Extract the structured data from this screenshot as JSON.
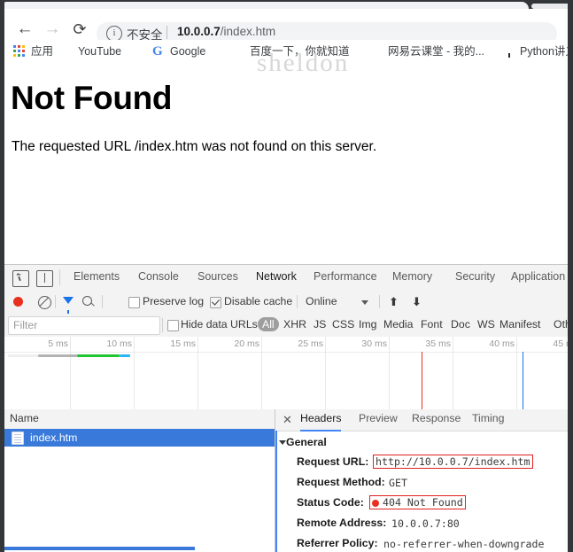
{
  "browser": {
    "nav": {
      "back": "←",
      "forward": "→",
      "reload": "⟳"
    },
    "omnibox": {
      "info_icon": "i",
      "security_label": "不安全",
      "separator": "|",
      "host": "10.0.0.7",
      "path": "/index.htm"
    },
    "bookmarks": [
      {
        "label": "应用",
        "icon": "apps-grid-icon"
      },
      {
        "label": "YouTube",
        "icon": "youtube-icon"
      },
      {
        "label": "Google",
        "icon": "google-icon",
        "glyph": "G"
      },
      {
        "label": "百度一下，你就知道",
        "icon": "baidu-icon"
      },
      {
        "label": "网易云课堂 - 我的...",
        "icon": "netease-icon"
      },
      {
        "label": "Python讲义",
        "icon": "github-icon"
      }
    ]
  },
  "page": {
    "heading": "Not Found",
    "body": "The requested URL /index.htm was not found on this server.",
    "watermark": "sheldon"
  },
  "devtools": {
    "tabs": [
      {
        "label": "Elements",
        "active": false
      },
      {
        "label": "Console",
        "active": false
      },
      {
        "label": "Sources",
        "active": false
      },
      {
        "label": "Network",
        "active": true
      },
      {
        "label": "Performance",
        "active": false
      },
      {
        "label": "Memory",
        "active": false
      },
      {
        "label": "Security",
        "active": false
      },
      {
        "label": "Application",
        "active": false
      }
    ],
    "toolbar": {
      "record_title": "record",
      "clear_title": "clear",
      "preserve_log": {
        "label": "Preserve log",
        "checked": false
      },
      "disable_cache": {
        "label": "Disable cache",
        "checked": true
      },
      "throttling": "Online",
      "import_arrow": "⬆",
      "export_arrow": "⬇"
    },
    "filter": {
      "placeholder": "Filter",
      "hide_data_urls": {
        "label": "Hide data URLs",
        "checked": false
      },
      "types": [
        "All",
        "XHR",
        "JS",
        "CSS",
        "Img",
        "Media",
        "Font",
        "Doc",
        "WS",
        "Manifest",
        "Oth"
      ]
    },
    "timeline": {
      "ticks": [
        "5 ms",
        "10 ms",
        "15 ms",
        "20 ms",
        "25 ms",
        "30 ms",
        "35 ms",
        "40 ms",
        "45 ms"
      ],
      "bands": [
        {
          "name": "stalled",
          "color": "#efefef"
        },
        {
          "name": "queued",
          "color": "#b3b3b3"
        },
        {
          "name": "request-sent",
          "color": "#21c531"
        },
        {
          "name": "content-download",
          "color": "#29b6f6"
        }
      ],
      "markers": [
        {
          "name": "dom-content-loaded",
          "color": "#e8301f",
          "label": "35 ms"
        },
        {
          "name": "load",
          "color": "#1a73e8",
          "label": "44 ms"
        }
      ]
    },
    "requests": {
      "column_header": "Name",
      "rows": [
        {
          "name": "index.htm",
          "selected": true,
          "icon": "document-icon"
        }
      ]
    },
    "details": {
      "close_icon": "✕",
      "tabs": [
        {
          "label": "Headers",
          "active": true
        },
        {
          "label": "Preview",
          "active": false
        },
        {
          "label": "Response",
          "active": false
        },
        {
          "label": "Timing",
          "active": false
        }
      ],
      "section": "General",
      "fields": [
        {
          "key": "Request URL:",
          "value": "http://10.0.0.7/index.htm",
          "highlighted": true
        },
        {
          "key": "Request Method:",
          "value": "GET",
          "highlighted": false
        },
        {
          "key": "Status Code:",
          "value": "404 Not Found",
          "highlighted": true,
          "status_dot": true
        },
        {
          "key": "Remote Address:",
          "value": "10.0.0.7:80",
          "highlighted": false
        },
        {
          "key": "Referrer Policy:",
          "value": "no-referrer-when-downgrade",
          "highlighted": false
        }
      ]
    }
  },
  "colors": {
    "accent": "#4285f4",
    "error": "#e8301f",
    "selection": "#3879d9",
    "frame": "#33373a"
  }
}
